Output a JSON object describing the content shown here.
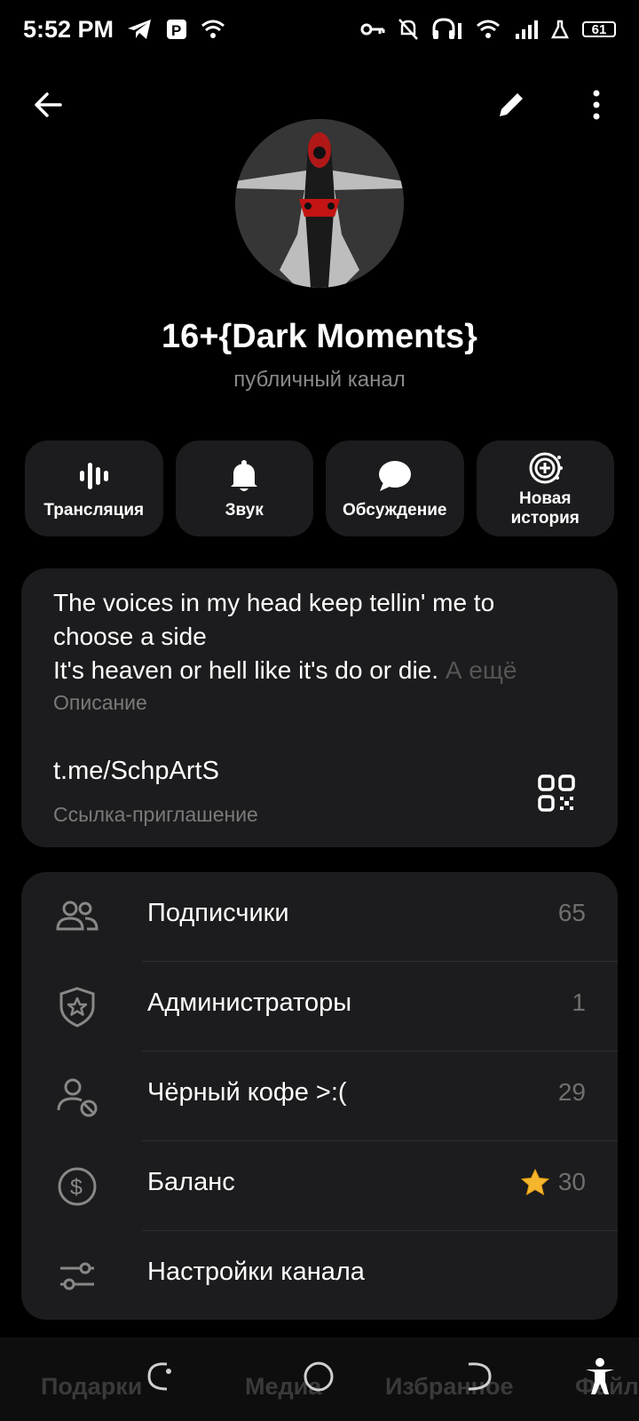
{
  "status": {
    "time": "5:52 PM",
    "battery": "61"
  },
  "profile": {
    "title": "16+{Dark Moments}",
    "subtitle": "публичный канал"
  },
  "actions": [
    {
      "label": "Трансляция",
      "icon": "live-stream-icon"
    },
    {
      "label": "Звук",
      "icon": "bell-icon"
    },
    {
      "label": "Обсуждение",
      "icon": "chat-bubble-icon"
    },
    {
      "label": "Новая история",
      "icon": "new-story-icon"
    }
  ],
  "info": {
    "description_line1": "The voices in my head keep tellin' me to",
    "description_line2": "choose a side",
    "description_line3": "It's heaven or hell like it's do or die.",
    "more_label": "А ещё",
    "description_caption": "Описание",
    "link": "t.me/SchpArtS",
    "link_caption": "Ссылка-приглашение"
  },
  "menu": [
    {
      "label": "Подписчики",
      "value": "65",
      "icon": "people-icon"
    },
    {
      "label": "Администраторы",
      "value": "1",
      "icon": "shield-star-icon"
    },
    {
      "label": "Чёрный кофе >:(",
      "value": "29",
      "icon": "user-blocked-icon"
    },
    {
      "label": "Баланс",
      "value": "30",
      "icon": "dollar-circle-icon"
    },
    {
      "label": "Настройки канала",
      "value": "",
      "icon": "sliders-icon"
    }
  ],
  "tabs": [
    "Подарки",
    "Медиа",
    "Избранное",
    "Файлы"
  ],
  "colors": {
    "background": "#000000",
    "card": "#1c1c1e",
    "star": "#f5b62e"
  }
}
